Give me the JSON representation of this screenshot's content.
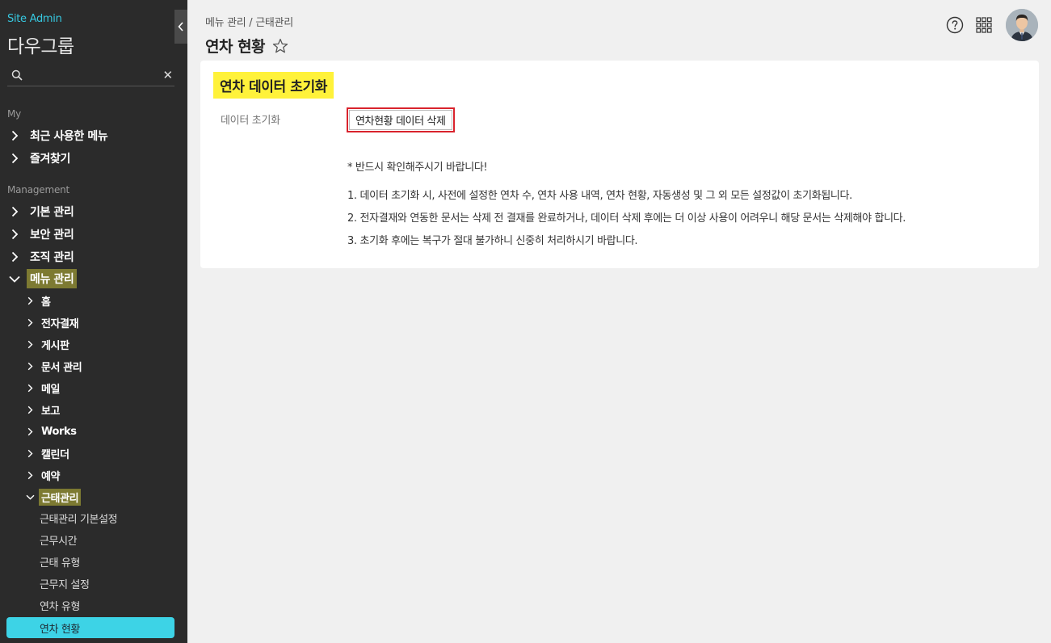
{
  "sidebar": {
    "site_admin": "Site Admin",
    "group_name": "다우그룹",
    "search": {
      "value": "",
      "placeholder": ""
    },
    "sections": {
      "my": "My",
      "management": "Management"
    },
    "my_items": [
      "최근 사용한 메뉴",
      "즐겨찾기"
    ],
    "management_items": [
      "기본 관리",
      "보안 관리",
      "조직 관리",
      "메뉴 관리"
    ],
    "menu_children": [
      "홈",
      "전자결재",
      "게시판",
      "문서 관리",
      "메일",
      "보고",
      "Works",
      "캘린더",
      "예약",
      "근태관리"
    ],
    "attendance_children": [
      "근태관리 기본설정",
      "근무시간",
      "근태 유형",
      "근무지 설정",
      "연차 유형",
      "연차 현황"
    ],
    "selected_item": "연차 현황",
    "accent_color": "#3dd3e6",
    "active_highlight_color": "#7d7a32"
  },
  "header": {
    "breadcrumb": "메뉴 관리 / 근태관리",
    "title": "연차 현황"
  },
  "card": {
    "heading": "연차 데이터 초기화",
    "row_label": "데이터 초기화",
    "delete_button": "연차현황 데이터 삭제",
    "notice_title": "* 반드시 확인해주시기 바랍니다!",
    "notices": [
      "1. 데이터 초기화 시, 사전에 설정한 연차 수, 연차 사용 내역, 연차 현황, 자동생성 및 그 외 모든 설정값이 초기화됩니다.",
      "2. 전자결재와 연동한 문서는 삭제 전 결재를 완료하거나, 데이터 삭제 후에는 더 이상 사용이 어려우니 해당 문서는 삭제해야 합니다.",
      "3. 초기화 후에는 복구가 절대 불가하니 신중히 처리하시기 바랍니다."
    ],
    "heading_highlight_color": "#fff23a",
    "button_border_color": "#d9232d"
  }
}
